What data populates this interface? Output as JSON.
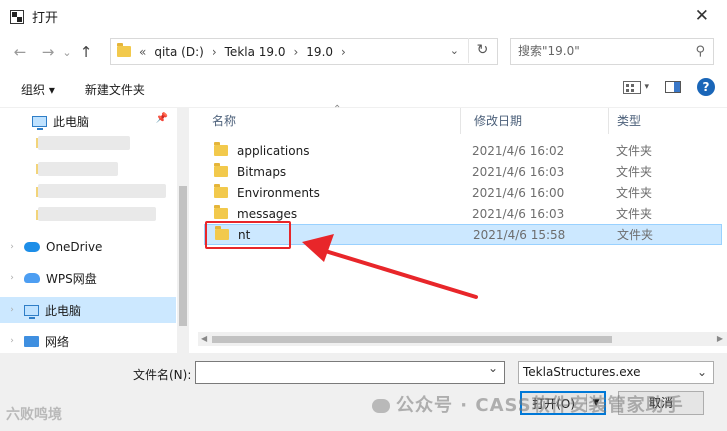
{
  "window": {
    "title": "打开",
    "close_glyph": "✕"
  },
  "nav": {
    "back_glyph": "←",
    "forward_glyph": "→",
    "recent_glyph": "⌄",
    "up_glyph": "↑",
    "breadcrumb": [
      "«",
      "qita (D:)",
      "›",
      "Tekla 19.0",
      "›",
      "19.0",
      "›"
    ],
    "chevron_glyph": "⌄",
    "refresh_glyph": "↻",
    "search_placeholder": "搜索\"19.0\"",
    "search_glyph": "⚲"
  },
  "toolbar": {
    "organize": "组织 ▾",
    "new_folder": "新建文件夹",
    "view_dd": "▾",
    "help": "?"
  },
  "sidebar": {
    "items": [
      {
        "label": "此电脑",
        "arrow": ""
      },
      {
        "label": "OneDrive",
        "arrow": "›"
      },
      {
        "label": "WPS网盘",
        "arrow": "›"
      },
      {
        "label": "此电脑",
        "arrow": "›"
      },
      {
        "label": "网络",
        "arrow": "›"
      }
    ],
    "pin_glyph": "📌"
  },
  "columns": {
    "name": "名称",
    "date": "修改日期",
    "type": "类型",
    "sort_glyph": "⌃"
  },
  "files": [
    {
      "name": "applications",
      "date": "2021/4/6 16:02",
      "type": "文件夹"
    },
    {
      "name": "Bitmaps",
      "date": "2021/4/6 16:03",
      "type": "文件夹"
    },
    {
      "name": "Environments",
      "date": "2021/4/6 16:00",
      "type": "文件夹"
    },
    {
      "name": "messages",
      "date": "2021/4/6 16:03",
      "type": "文件夹"
    },
    {
      "name": "nt",
      "date": "2021/4/6 15:58",
      "type": "文件夹"
    }
  ],
  "scroll": {
    "left": "◀",
    "right": "▶"
  },
  "footer": {
    "filename_label": "文件名(N):",
    "filename_value": "",
    "filter": "TeklaStructures.exe",
    "filter_chevron": "⌄",
    "open": "打开(O)",
    "open_dd": "▼",
    "cancel": "取消"
  },
  "watermark": {
    "left": "六败鸣境",
    "right": "公众号 · CASS软件安装管家助手"
  },
  "colors": {
    "selection": "#cce8ff",
    "annotation": "#e8262a",
    "accent": "#0078d7"
  }
}
